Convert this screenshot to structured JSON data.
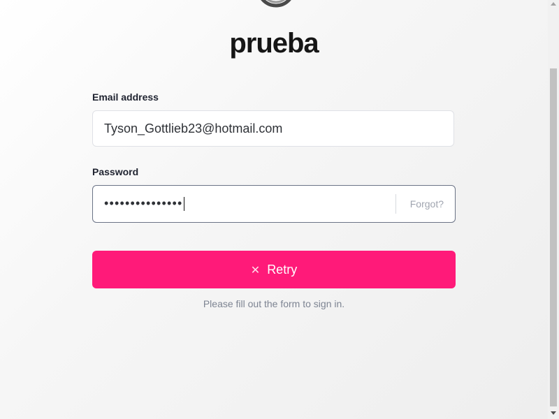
{
  "app": {
    "title": "prueba",
    "logo_icon": "ring-logo-icon"
  },
  "form": {
    "email": {
      "label": "Email address",
      "value": "Tyson_Gottlieb23@hotmail.com"
    },
    "password": {
      "label": "Password",
      "masked_value": "•••••••••••••••",
      "forgot_label": "Forgot?"
    },
    "submit": {
      "label": "Retry",
      "icon": "close-icon"
    },
    "help_text": "Please fill out the form to sign in."
  },
  "colors": {
    "accent": "#ff1a79",
    "text": "#161616",
    "muted": "#7d8492"
  }
}
